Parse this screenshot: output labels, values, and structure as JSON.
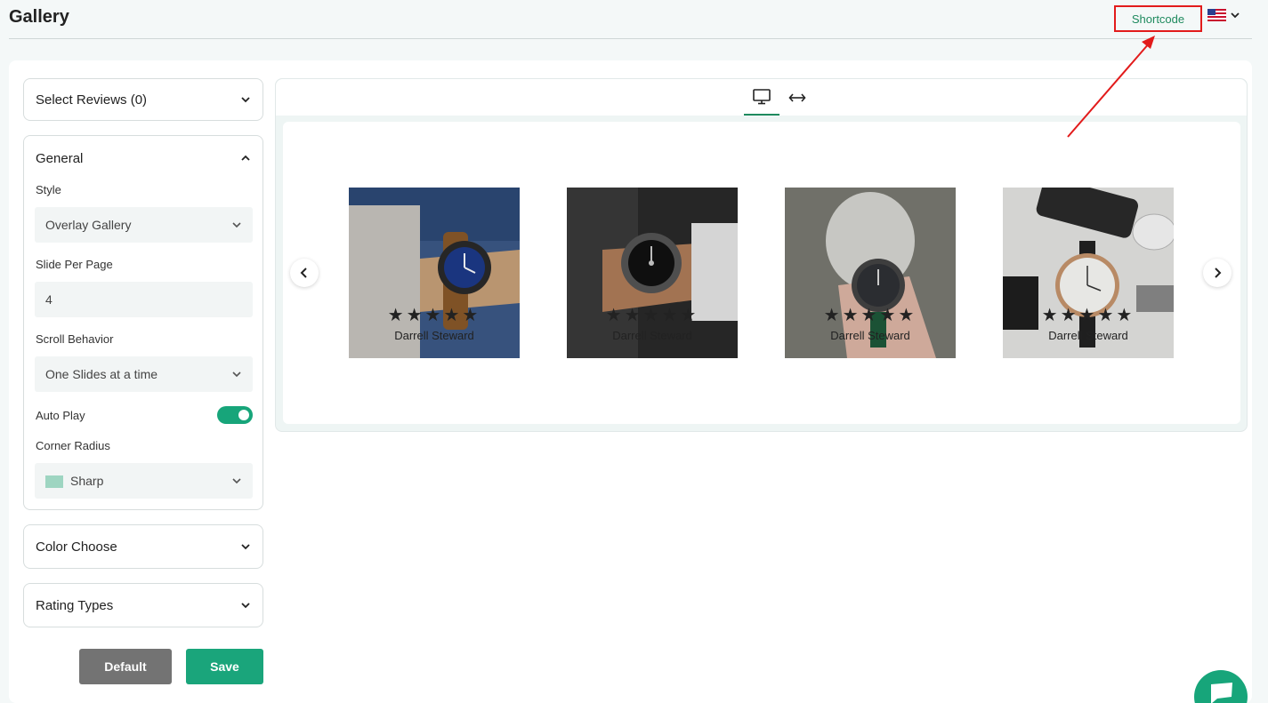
{
  "header": {
    "title": "Gallery",
    "shortcode_label": "Shortcode",
    "language_icon": "us-flag-icon"
  },
  "sidebar": {
    "select_reviews": {
      "label": "Select Reviews (0)"
    },
    "general": {
      "label": "General",
      "style": {
        "label": "Style",
        "value": "Overlay Gallery"
      },
      "slide_per_page": {
        "label": "Slide Per Page",
        "value": "4"
      },
      "scroll_behavior": {
        "label": "Scroll Behavior",
        "value": "One Slides at a time"
      },
      "auto_play": {
        "label": "Auto Play",
        "enabled": true
      },
      "corner_radius": {
        "label": "Corner Radius",
        "value": "Sharp",
        "swatch_color": "#9ed5c1"
      }
    },
    "color_choose": {
      "label": "Color Choose"
    },
    "rating_types": {
      "label": "Rating Types"
    },
    "buttons": {
      "default_label": "Default",
      "save_label": "Save"
    }
  },
  "preview": {
    "tabs": [
      "desktop-icon",
      "full-width-icon"
    ],
    "active_tab": "desktop-icon",
    "slides": [
      {
        "stars": "★★★★★",
        "rating": 5,
        "reviewer": "Darrell Steward",
        "image": "watch-blue-dial-on-wrist"
      },
      {
        "stars": "★★★★★",
        "rating": 5,
        "reviewer": "Darrell Steward",
        "image": "watch-black-dial-on-wrist"
      },
      {
        "stars": "★★★★★",
        "rating": 5,
        "reviewer": "Darrell Steward",
        "image": "watch-in-hand-with-dog"
      },
      {
        "stars": "★★★★★",
        "rating": 5,
        "reviewer": "Darrell Steward",
        "image": "watch-white-dial-on-table"
      }
    ]
  },
  "colors": {
    "accent": "#17a57a",
    "shortcode_text": "#1e8a5e",
    "highlight_red": "#e21b1b",
    "default_button": "#737373"
  }
}
